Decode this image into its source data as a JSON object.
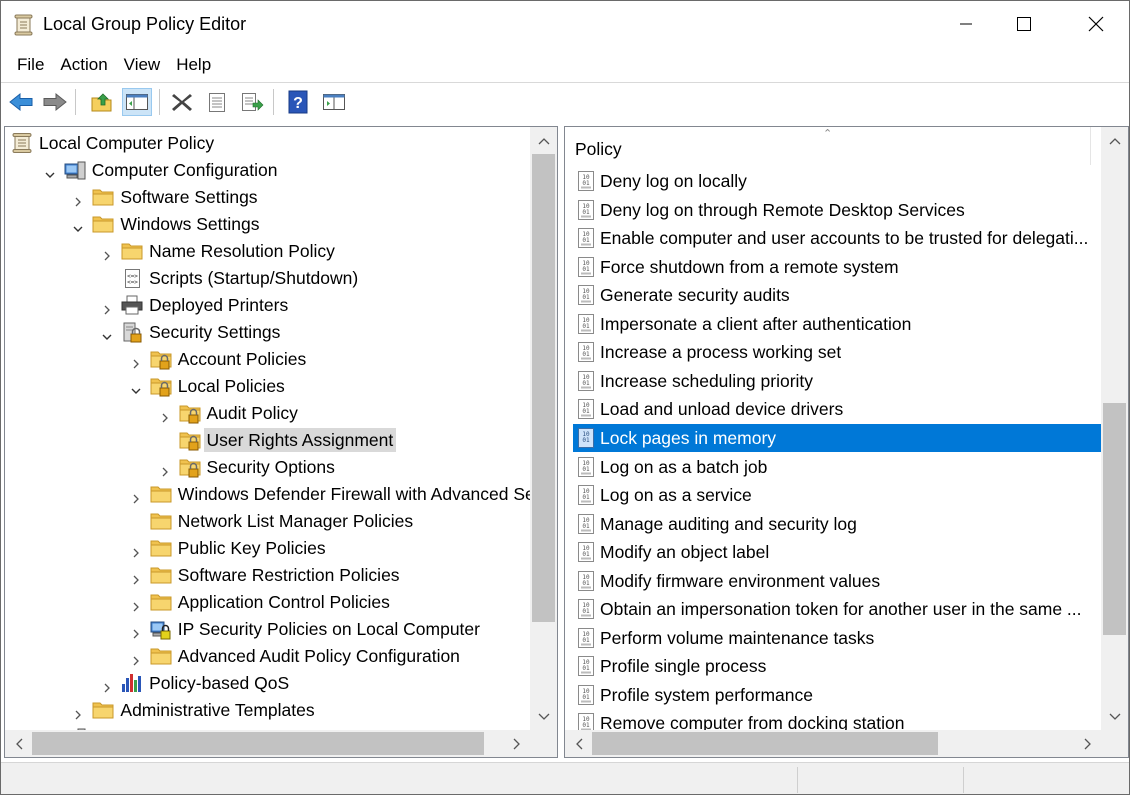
{
  "window": {
    "title": "Local Group Policy Editor"
  },
  "menu": [
    "File",
    "Action",
    "View",
    "Help"
  ],
  "toolbar": {
    "buttons": [
      "back-icon",
      "forward-icon",
      "up-folder-icon",
      "show-hide-tree-icon",
      "delete-icon",
      "properties-icon",
      "export-list-icon",
      "help-icon",
      "console-view-icon"
    ]
  },
  "tree": {
    "items": [
      {
        "label": "Local Computer Policy",
        "icon": "policy-scroll-icon",
        "depth": 0,
        "expander": "none"
      },
      {
        "label": "Computer Configuration",
        "icon": "computer-icon",
        "depth": 1,
        "expander": "expanded"
      },
      {
        "label": "Software Settings",
        "icon": "folder-icon",
        "depth": 2,
        "expander": "collapsed"
      },
      {
        "label": "Windows Settings",
        "icon": "folder-icon",
        "depth": 2,
        "expander": "expanded"
      },
      {
        "label": "Name Resolution Policy",
        "icon": "folder-icon",
        "depth": 3,
        "expander": "collapsed"
      },
      {
        "label": "Scripts (Startup/Shutdown)",
        "icon": "script-icon",
        "depth": 3,
        "expander": "none"
      },
      {
        "label": "Deployed Printers",
        "icon": "printer-icon",
        "depth": 3,
        "expander": "collapsed"
      },
      {
        "label": "Security Settings",
        "icon": "security-settings-icon",
        "depth": 3,
        "expander": "expanded"
      },
      {
        "label": "Account Policies",
        "icon": "locked-folder-icon",
        "depth": 4,
        "expander": "collapsed"
      },
      {
        "label": "Local Policies",
        "icon": "locked-folder-icon",
        "depth": 4,
        "expander": "expanded"
      },
      {
        "label": "Audit Policy",
        "icon": "locked-folder-icon",
        "depth": 5,
        "expander": "collapsed"
      },
      {
        "label": "User Rights Assignment",
        "icon": "locked-folder-icon",
        "depth": 5,
        "expander": "none",
        "selected": true
      },
      {
        "label": "Security Options",
        "icon": "locked-folder-icon",
        "depth": 5,
        "expander": "collapsed"
      },
      {
        "label": "Windows Defender Firewall with Advanced Secur",
        "icon": "folder-icon",
        "depth": 4,
        "expander": "collapsed"
      },
      {
        "label": "Network List Manager Policies",
        "icon": "folder-icon",
        "depth": 4,
        "expander": "none"
      },
      {
        "label": "Public Key Policies",
        "icon": "folder-icon",
        "depth": 4,
        "expander": "collapsed"
      },
      {
        "label": "Software Restriction Policies",
        "icon": "folder-icon",
        "depth": 4,
        "expander": "collapsed"
      },
      {
        "label": "Application Control Policies",
        "icon": "folder-icon",
        "depth": 4,
        "expander": "collapsed"
      },
      {
        "label": "IP Security Policies on Local Computer",
        "icon": "ip-security-icon",
        "depth": 4,
        "expander": "collapsed"
      },
      {
        "label": "Advanced Audit Policy Configuration",
        "icon": "folder-icon",
        "depth": 4,
        "expander": "collapsed"
      },
      {
        "label": "Policy-based QoS",
        "icon": "qos-chart-icon",
        "depth": 3,
        "expander": "collapsed"
      },
      {
        "label": "Administrative Templates",
        "icon": "folder-icon",
        "depth": 2,
        "expander": "collapsed"
      }
    ]
  },
  "list": {
    "column_header": "Policy",
    "items": [
      {
        "label": "Deny log on locally"
      },
      {
        "label": "Deny log on through Remote Desktop Services"
      },
      {
        "label": "Enable computer and user accounts to be trusted for delegati..."
      },
      {
        "label": "Force shutdown from a remote system"
      },
      {
        "label": "Generate security audits"
      },
      {
        "label": "Impersonate a client after authentication"
      },
      {
        "label": "Increase a process working set"
      },
      {
        "label": "Increase scheduling priority"
      },
      {
        "label": "Load and unload device drivers"
      },
      {
        "label": "Lock pages in memory",
        "selected": true
      },
      {
        "label": "Log on as a batch job"
      },
      {
        "label": "Log on as a service"
      },
      {
        "label": "Manage auditing and security log"
      },
      {
        "label": "Modify an object label"
      },
      {
        "label": "Modify firmware environment values"
      },
      {
        "label": "Obtain an impersonation token for another user in the same ..."
      },
      {
        "label": "Perform volume maintenance tasks"
      },
      {
        "label": "Profile single process"
      },
      {
        "label": "Profile system performance"
      },
      {
        "label": "Remove computer from docking station"
      }
    ]
  },
  "colors": {
    "selection": "#0078d7",
    "tree_selection": "#d9d9d9",
    "folder": "#f5cf5d"
  }
}
